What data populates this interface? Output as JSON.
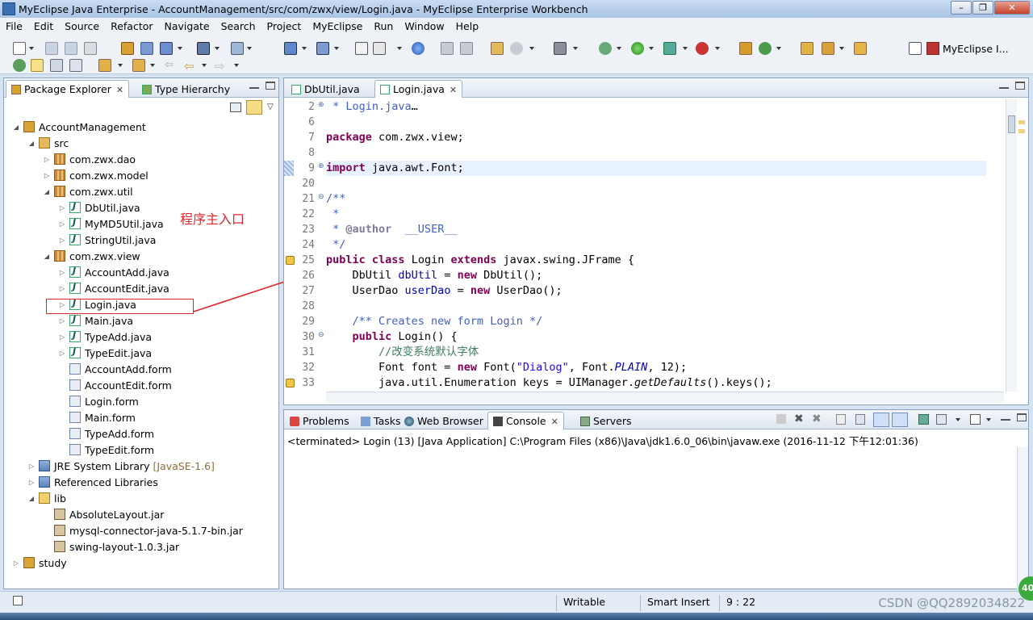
{
  "window": {
    "title": "MyEclipse Java Enterprise - AccountManagement/src/com/zwx/view/Login.java - MyEclipse Enterprise Workbench"
  },
  "menu": [
    "File",
    "Edit",
    "Source",
    "Refactor",
    "Navigate",
    "Search",
    "Project",
    "MyEclipse",
    "Run",
    "Window",
    "Help"
  ],
  "perspective": {
    "label": "MyEclipse I..."
  },
  "explorer": {
    "tabs": [
      "Package Explorer",
      "Type Hierarchy"
    ],
    "tree": [
      {
        "label": "AccountManagement",
        "icon": "project-icon",
        "level": 0,
        "expanded": true
      },
      {
        "label": "src",
        "icon": "source-folder-icon",
        "level": 1,
        "expanded": true
      },
      {
        "label": "com.zwx.dao",
        "icon": "package-icon",
        "level": 2,
        "expanded": false
      },
      {
        "label": "com.zwx.model",
        "icon": "package-icon",
        "level": 2,
        "expanded": false
      },
      {
        "label": "com.zwx.util",
        "icon": "package-icon",
        "level": 2,
        "expanded": true
      },
      {
        "label": "DbUtil.java",
        "icon": "java-file-icon",
        "level": 3,
        "expanded": false
      },
      {
        "label": "MyMD5Util.java",
        "icon": "java-file-icon",
        "level": 3,
        "expanded": false
      },
      {
        "label": "StringUtil.java",
        "icon": "java-file-icon",
        "level": 3,
        "expanded": false
      },
      {
        "label": "com.zwx.view",
        "icon": "package-icon",
        "level": 2,
        "expanded": true
      },
      {
        "label": "AccountAdd.java",
        "icon": "java-file-icon",
        "level": 3,
        "expanded": false
      },
      {
        "label": "AccountEdit.java",
        "icon": "java-file-icon",
        "level": 3,
        "expanded": false
      },
      {
        "label": "Login.java",
        "icon": "java-file-icon",
        "level": 3,
        "expanded": false
      },
      {
        "label": "Main.java",
        "icon": "java-file-icon",
        "level": 3,
        "expanded": false
      },
      {
        "label": "TypeAdd.java",
        "icon": "java-file-icon",
        "level": 3,
        "expanded": false
      },
      {
        "label": "TypeEdit.java",
        "icon": "java-file-icon",
        "level": 3,
        "expanded": false
      },
      {
        "label": "AccountAdd.form",
        "icon": "form-file-icon",
        "level": 3,
        "leaf": true
      },
      {
        "label": "AccountEdit.form",
        "icon": "form-file-icon",
        "level": 3,
        "leaf": true
      },
      {
        "label": "Login.form",
        "icon": "form-file-icon",
        "level": 3,
        "leaf": true
      },
      {
        "label": "Main.form",
        "icon": "form-file-icon",
        "level": 3,
        "leaf": true
      },
      {
        "label": "TypeAdd.form",
        "icon": "form-file-icon",
        "level": 3,
        "leaf": true
      },
      {
        "label": "TypeEdit.form",
        "icon": "form-file-icon",
        "level": 3,
        "leaf": true
      },
      {
        "label": "JRE System Library",
        "suffix": "[JavaSE-1.6]",
        "icon": "library-icon",
        "level": 1,
        "expanded": false
      },
      {
        "label": "Referenced Libraries",
        "icon": "library-icon",
        "level": 1,
        "expanded": false
      },
      {
        "label": "lib",
        "icon": "folder-icon",
        "level": 1,
        "expanded": true
      },
      {
        "label": "AbsoluteLayout.jar",
        "icon": "jar-icon",
        "level": 2,
        "leaf": true
      },
      {
        "label": "mysql-connector-java-5.1.7-bin.jar",
        "icon": "jar-icon",
        "level": 2,
        "leaf": true
      },
      {
        "label": "swing-layout-1.0.3.jar",
        "icon": "jar-icon",
        "level": 2,
        "leaf": true
      },
      {
        "label": "study",
        "icon": "project-icon",
        "level": 0,
        "expanded": false
      }
    ],
    "annotation": "程序主入口"
  },
  "editor": {
    "tabs": [
      "DbUtil.java",
      "Login.java"
    ],
    "lines": [
      {
        "n": "2",
        "fold": "plus",
        "parts": [
          {
            "t": " * Login.java",
            "c": "cm"
          },
          {
            "t": "…",
            "c": ""
          }
        ]
      },
      {
        "n": "6",
        "parts": []
      },
      {
        "n": "7",
        "parts": [
          {
            "t": "package",
            "c": "kw"
          },
          {
            "t": " com.zwx.view;",
            "c": ""
          }
        ]
      },
      {
        "n": "8",
        "parts": []
      },
      {
        "n": "9",
        "fold": "plus",
        "current": true,
        "parts": [
          {
            "t": "import",
            "c": "kw"
          },
          {
            "t": " java.awt.Font;",
            "c": ""
          }
        ]
      },
      {
        "n": "20",
        "parts": []
      },
      {
        "n": "21",
        "fold": "minus",
        "parts": [
          {
            "t": "/**",
            "c": "cm"
          }
        ]
      },
      {
        "n": "22",
        "parts": [
          {
            "t": " *",
            "c": "cm"
          }
        ]
      },
      {
        "n": "23",
        "parts": [
          {
            "t": " * ",
            "c": "cm"
          },
          {
            "t": "@author",
            "c": "ann"
          },
          {
            "t": "  __USER__",
            "c": "cm"
          }
        ]
      },
      {
        "n": "24",
        "parts": [
          {
            "t": " */",
            "c": "cm"
          }
        ]
      },
      {
        "n": "25",
        "marker": true,
        "parts": [
          {
            "t": "public",
            "c": "kw"
          },
          {
            "t": " ",
            "c": ""
          },
          {
            "t": "class",
            "c": "kw"
          },
          {
            "t": " Login ",
            "c": ""
          },
          {
            "t": "extends",
            "c": "kw"
          },
          {
            "t": " javax.swing.JFrame {",
            "c": ""
          }
        ]
      },
      {
        "n": "26",
        "parts": [
          {
            "t": "    DbUtil ",
            "c": ""
          },
          {
            "t": "dbUtil",
            "c": "fld"
          },
          {
            "t": " = ",
            "c": ""
          },
          {
            "t": "new",
            "c": "kw"
          },
          {
            "t": " DbUtil();",
            "c": ""
          }
        ]
      },
      {
        "n": "27",
        "parts": [
          {
            "t": "    UserDao ",
            "c": ""
          },
          {
            "t": "userDao",
            "c": "fld"
          },
          {
            "t": " = ",
            "c": ""
          },
          {
            "t": "new",
            "c": "kw"
          },
          {
            "t": " UserDao();",
            "c": ""
          }
        ]
      },
      {
        "n": "28",
        "parts": []
      },
      {
        "n": "29",
        "parts": [
          {
            "t": "    /** Creates new form Login */",
            "c": "cm"
          }
        ]
      },
      {
        "n": "30",
        "fold": "minus",
        "parts": [
          {
            "t": "    ",
            "c": ""
          },
          {
            "t": "public",
            "c": "kw"
          },
          {
            "t": " Login() {",
            "c": ""
          }
        ]
      },
      {
        "n": "31",
        "parts": [
          {
            "t": "        //改变系统默认字体",
            "c": "ln-comment"
          }
        ]
      },
      {
        "n": "32",
        "parts": [
          {
            "t": "        Font font = ",
            "c": ""
          },
          {
            "t": "new",
            "c": "kw"
          },
          {
            "t": " Font(",
            "c": ""
          },
          {
            "t": "\"Dialog\"",
            "c": "str"
          },
          {
            "t": ", Font.",
            "c": ""
          },
          {
            "t": "PLAIN",
            "c": "fld ital"
          },
          {
            "t": ", 12);",
            "c": ""
          }
        ]
      },
      {
        "n": "33",
        "marker": true,
        "parts": [
          {
            "t": "        java.util.Enumeration keys = UIManager.",
            "c": ""
          },
          {
            "t": "getDefaults",
            "c": "ital"
          },
          {
            "t": "().keys();",
            "c": ""
          }
        ]
      }
    ]
  },
  "bottom": {
    "tabs": [
      "Problems",
      "Tasks",
      "Web Browser",
      "Console",
      "Servers"
    ],
    "console_text": "<terminated> Login (13) [Java Application] C:\\Program Files (x86)\\Java\\jdk1.6.0_06\\bin\\javaw.exe (2016-11-12 下午12:01:36)"
  },
  "status": {
    "writable": "Writable",
    "insert_mode": "Smart Insert",
    "position": "9 : 22"
  },
  "watermark": "CSDN @QQ2892034822",
  "badge": "40",
  "colors": {
    "keyword": "#7f0055",
    "comment": "#3f5fbf",
    "annotation_red": "#e0262a"
  }
}
